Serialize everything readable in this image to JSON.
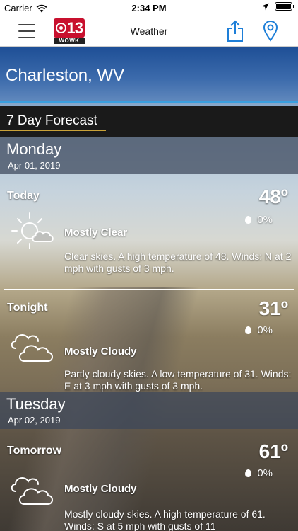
{
  "status": {
    "carrier": "Carrier",
    "time": "2:34 PM"
  },
  "nav": {
    "title": "Weather",
    "logo_number": "13",
    "logo_call": "WOWK"
  },
  "location": {
    "city": "Charleston, WV"
  },
  "forecast_title": "7 Day Forecast",
  "days": [
    {
      "name": "Monday",
      "date": "Apr 01, 2019",
      "periods": [
        {
          "label": "Today",
          "temp": "48º",
          "precip": "0%",
          "icon": "partly-sunny-icon",
          "condition": "Mostly Clear",
          "description": "Clear skies.  A high temperature of 48.  Winds: N at 2 mph with gusts of 3 mph."
        },
        {
          "label": "Tonight",
          "temp": "31º",
          "precip": "0%",
          "icon": "cloudy-icon",
          "condition": "Mostly Cloudy",
          "description": "Partly cloudy skies.  A low temperature of 31.  Winds: E at 3 mph with gusts of 3 mph."
        }
      ]
    },
    {
      "name": "Tuesday",
      "date": "Apr 02, 2019",
      "periods": [
        {
          "label": "Tomorrow",
          "temp": "61º",
          "precip": "0%",
          "icon": "cloudy-icon",
          "condition": "Mostly Cloudy",
          "description": "Mostly cloudy skies.  A high temperature of 61.  Winds: S at 5 mph with gusts of 11"
        }
      ]
    }
  ],
  "colors": {
    "accent": "#3aa0e0",
    "underline": "#c9a238",
    "brand_red": "#c8102e"
  }
}
